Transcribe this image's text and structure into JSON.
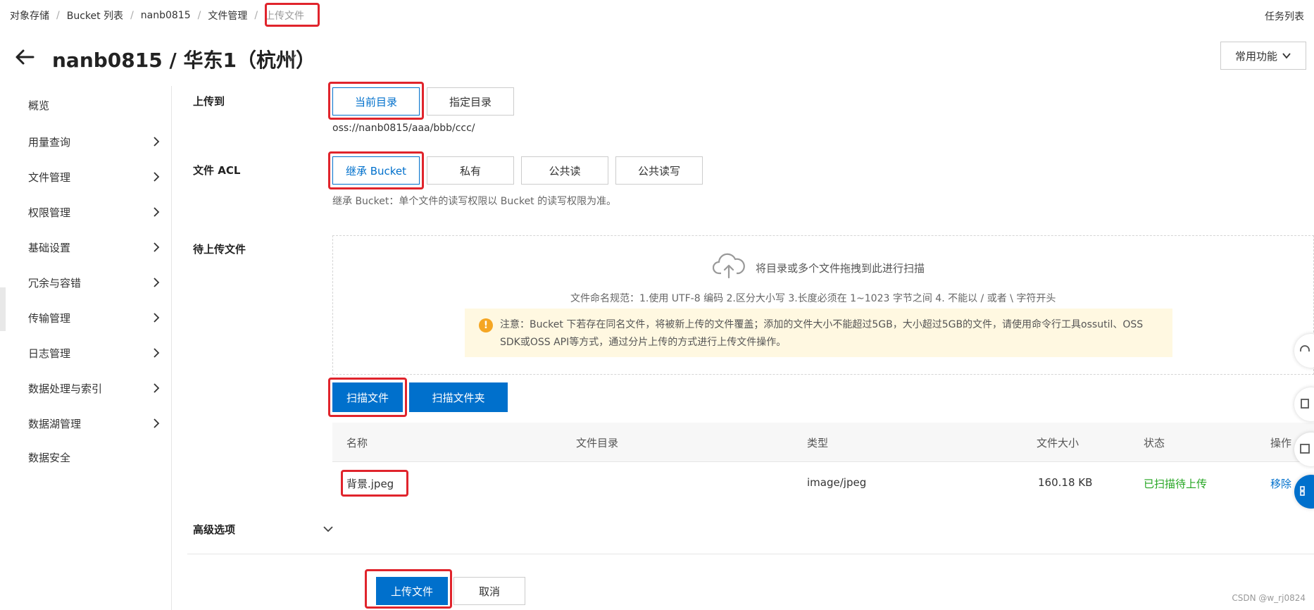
{
  "breadcrumb": {
    "items": [
      "对象存储",
      "Bucket 列表",
      "nanb0815",
      "文件管理",
      "上传文件"
    ],
    "separator": "/"
  },
  "header": {
    "task_list": "任务列表",
    "title": "nanb0815 / 华东1（杭州）",
    "common_functions": "常用功能"
  },
  "sidebar": {
    "items": [
      {
        "label": "概览"
      },
      {
        "label": "用量查询"
      },
      {
        "label": "文件管理"
      },
      {
        "label": "权限管理"
      },
      {
        "label": "基础设置"
      },
      {
        "label": "冗余与容错"
      },
      {
        "label": "传输管理"
      },
      {
        "label": "日志管理"
      },
      {
        "label": "数据处理与索引"
      },
      {
        "label": "数据湖管理"
      },
      {
        "label": "数据安全"
      }
    ]
  },
  "upload_to": {
    "label": "上传到",
    "options": [
      "当前目录",
      "指定目录"
    ],
    "selected": "当前目录",
    "path": "oss://nanb0815/aaa/bbb/ccc/"
  },
  "acl": {
    "label": "文件 ACL",
    "options": [
      "继承 Bucket",
      "私有",
      "公共读",
      "公共读写"
    ],
    "selected": "继承 Bucket",
    "hint": "继承 Bucket：单个文件的读写权限以 Bucket 的读写权限为准。"
  },
  "pending": {
    "label": "待上传文件",
    "drop_text": "将目录或多个文件拖拽到此进行扫描",
    "naming_rule": "文件命名规范：1.使用 UTF-8 编码 2.区分大小写 3.长度必须在 1~1023 字节之间 4. 不能以 / 或者 \\ 字符开头",
    "notice": "注意：Bucket 下若存在同名文件，将被新上传的文件覆盖；添加的文件大小不能超过5GB，大小超过5GB的文件，请使用命令行工具ossutil、OSS SDK或OSS API等方式，通过分片上传的方式进行上传文件操作。",
    "scan_files": "扫描文件",
    "scan_folder": "扫描文件夹"
  },
  "table": {
    "headers": [
      "名称",
      "文件目录",
      "类型",
      "文件大小",
      "状态",
      "操作"
    ],
    "rows": [
      {
        "name": "背景.jpeg",
        "dir": "",
        "type": "image/jpeg",
        "size": "160.18 KB",
        "status": "已扫描待上传",
        "action": "移除"
      }
    ]
  },
  "advanced": {
    "label": "高级选项"
  },
  "footer": {
    "upload": "上传文件",
    "cancel": "取消"
  },
  "watermark": "CSDN @w_rj0824",
  "colors": {
    "primary": "#0070cc",
    "highlight": "#e0242c",
    "success": "#23a520",
    "notice_bg": "#fff8e1",
    "warning": "#f5a623"
  },
  "icons": [
    "back-arrow-icon",
    "chevron-down-icon",
    "chevron-right-icon",
    "upload-cloud-icon",
    "warning-icon"
  ]
}
